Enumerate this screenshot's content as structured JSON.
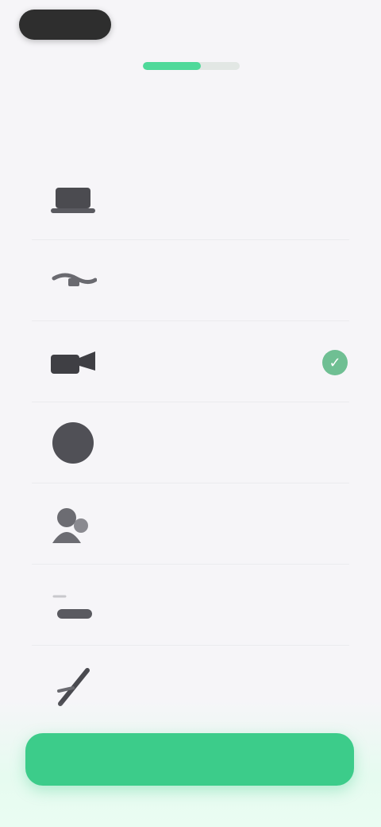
{
  "top_bar": {
    "back_label": "",
    "skip_label": ""
  },
  "progress": {
    "fraction": 0.6
  },
  "page": {
    "title": ""
  },
  "options": [
    {
      "icon": "laptop-icon",
      "label": "",
      "selected": false
    },
    {
      "icon": "cable-icon",
      "label": "",
      "selected": false
    },
    {
      "icon": "camera-icon",
      "label": "",
      "selected": true
    },
    {
      "icon": "globe-icon",
      "label": "",
      "selected": false
    },
    {
      "icon": "people-icon",
      "label": "",
      "selected": false
    },
    {
      "icon": "tray-icon",
      "label": "",
      "selected": false
    },
    {
      "icon": "pencil-icon",
      "label": "",
      "selected": false
    }
  ],
  "footer": {
    "continue_label": ""
  },
  "colors": {
    "accent": "#3ccc8a",
    "check": "#6fbf93",
    "background": "#f6f5f8"
  }
}
